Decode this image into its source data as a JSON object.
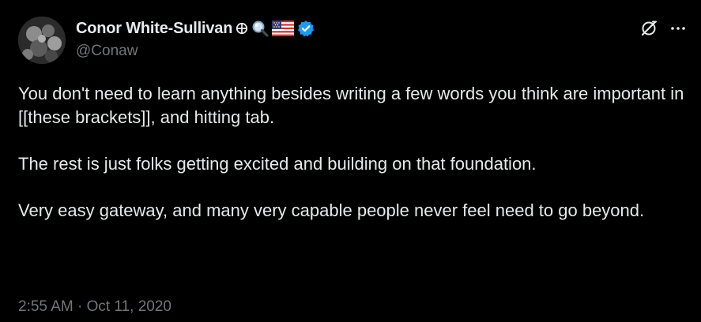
{
  "author": {
    "display_name": "Conor White-Sullivan",
    "handle": "@Conaw",
    "name_emojis": [
      "crosshair-circle-icon",
      "magnifier-icon",
      "us-flag-icon"
    ],
    "verified": true,
    "verified_color": "#1d9bf0"
  },
  "tweet": {
    "paragraphs": [
      "You don't need to learn anything besides writing a few words you think are important in [[these brackets]], and hitting tab.",
      "The rest is just folks getting excited and building on that foundation.",
      "Very easy gateway, and many very capable people never feel need to go beyond."
    ],
    "time": "2:55 AM",
    "separator": "·",
    "date": "Oct 11, 2020"
  },
  "actions": {
    "grok_icon": "grok-icon",
    "more_icon": "more-options-icon"
  },
  "colors": {
    "background": "#000000",
    "text": "#e7e9ea",
    "secondary": "#71767b"
  }
}
